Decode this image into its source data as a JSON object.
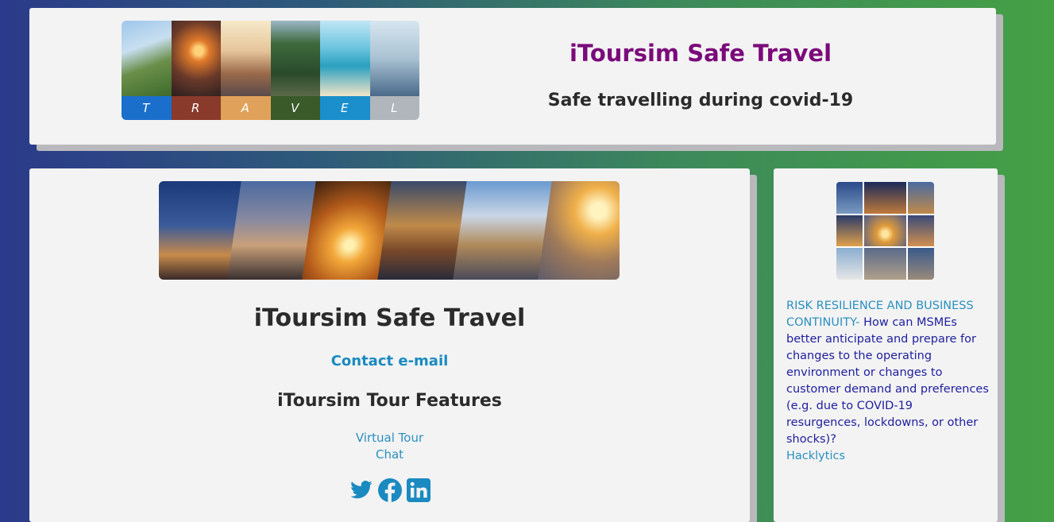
{
  "header": {
    "banner_letters": [
      "T",
      "R",
      "A",
      "V",
      "E",
      "L"
    ],
    "title": "iToursim Safe Travel",
    "subtitle": "Safe travelling during covid-19"
  },
  "main": {
    "title": "iToursim Safe Travel",
    "contact_link": "Contact e-mail",
    "features_title": "iToursim Tour Features",
    "feature_links": [
      "Virtual Tour",
      "Chat"
    ],
    "social": [
      "twitter-icon",
      "facebook-icon",
      "linkedin-icon"
    ]
  },
  "sidebar": {
    "article_link_prefix": "RISK RESILIENCE AND BUSINESS CONTINUITY-",
    "article_text": " How can MSMEs better anticipate and prepare for changes to the operating environment or changes to customer demand and preferences (e.g. due to COVID-19 resurgences, lockdowns, or other shocks)?",
    "article_source": "Hacklytics"
  },
  "colors": {
    "title_purple": "#7a0a7a",
    "link_blue": "#1a8ac0",
    "social_blue": "#1a8ac0"
  }
}
